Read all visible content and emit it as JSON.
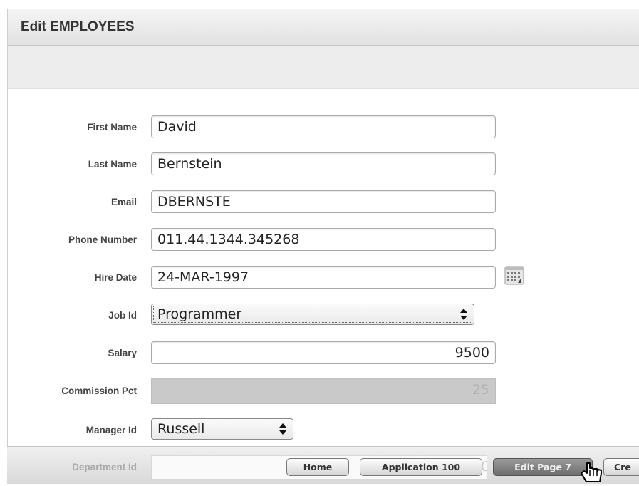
{
  "region": {
    "title": "Edit EMPLOYEES"
  },
  "form": {
    "first_name": {
      "label": "First Name",
      "value": "David"
    },
    "last_name": {
      "label": "Last Name",
      "value": "Bernstein"
    },
    "email": {
      "label": "Email",
      "value": "DBERNSTE"
    },
    "phone_number": {
      "label": "Phone Number",
      "value": "011.44.1344.345268"
    },
    "hire_date": {
      "label": "Hire Date",
      "value": "24-MAR-1997"
    },
    "job_id": {
      "label": "Job Id",
      "value": "Programmer"
    },
    "salary": {
      "label": "Salary",
      "value": "9500"
    },
    "commission_pct": {
      "label": "Commission Pct",
      "value": "25"
    },
    "manager_id": {
      "label": "Manager Id",
      "value": "Russell"
    },
    "department_id": {
      "label": "Department Id",
      "value": "0"
    }
  },
  "developer_toolbar": {
    "home": "Home",
    "application": "Application 100",
    "edit_page": "Edit Page 7",
    "create": "Cre"
  },
  "icons": {
    "calendar": "calendar-icon",
    "select_arrows": "up-down-arrows-icon",
    "cursor": "hand-pointer-icon"
  },
  "colors": {
    "header_bg": "#e8e8e8",
    "disabled_field": "#c9c9c9",
    "active_button": "#7f7f7f"
  }
}
